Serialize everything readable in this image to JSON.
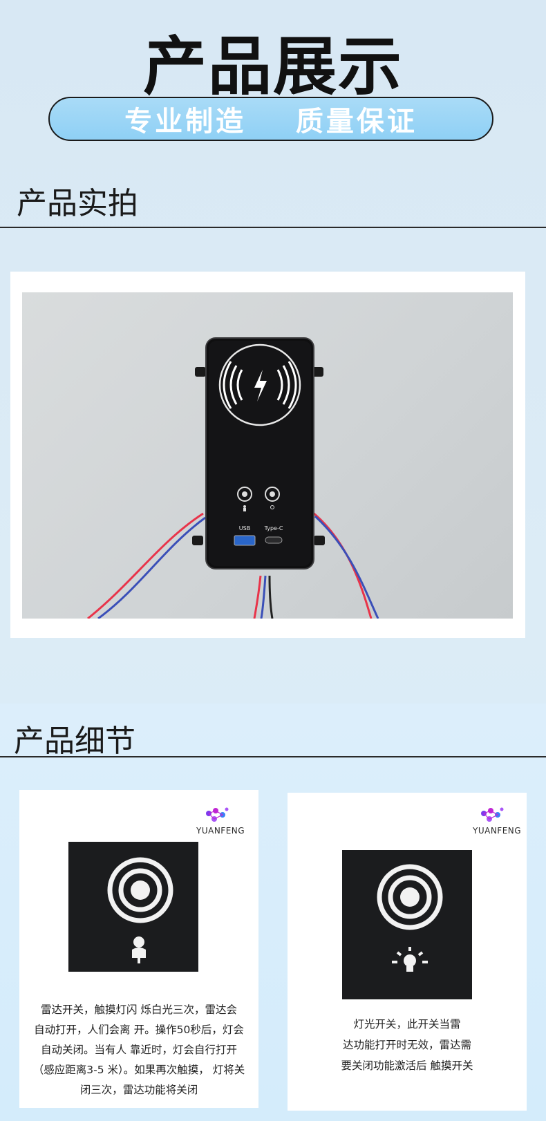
{
  "header": {
    "title": "产品展示",
    "banner_left": "专业制造",
    "banner_right": "质量保证"
  },
  "section_photo": {
    "title": "产品实拍",
    "device": {
      "usb_label": "USB",
      "typec_label": "Type-C"
    }
  },
  "section_details": {
    "title": "产品细节",
    "cards": [
      {
        "brand": "YUANFENG",
        "icon": "radar-person-icon",
        "lines": [
          "雷达开关，触摸灯闪 烁白光三次，雷达会",
          "自动打开，人们会离 开。操作50秒后，灯会",
          "自动关闭。当有人 靠近时，灯会自行打开",
          "（感应距离3-5 米）。如果再次触摸， 灯将关",
          "闭三次，雷达功能将关闭"
        ]
      },
      {
        "brand": "YUANFENG",
        "icon": "light-bulb-icon",
        "lines": [
          "灯光开关，此开关当雷",
          "达功能打开时无效，雷达需",
          "要关闭功能激活后 触摸开关"
        ]
      }
    ]
  },
  "colors": {
    "banner": "#a9dbf7",
    "background": "#d8e8f4",
    "device": "#111111",
    "wire_red": "#e8344a",
    "wire_blue": "#3a4fb8"
  }
}
